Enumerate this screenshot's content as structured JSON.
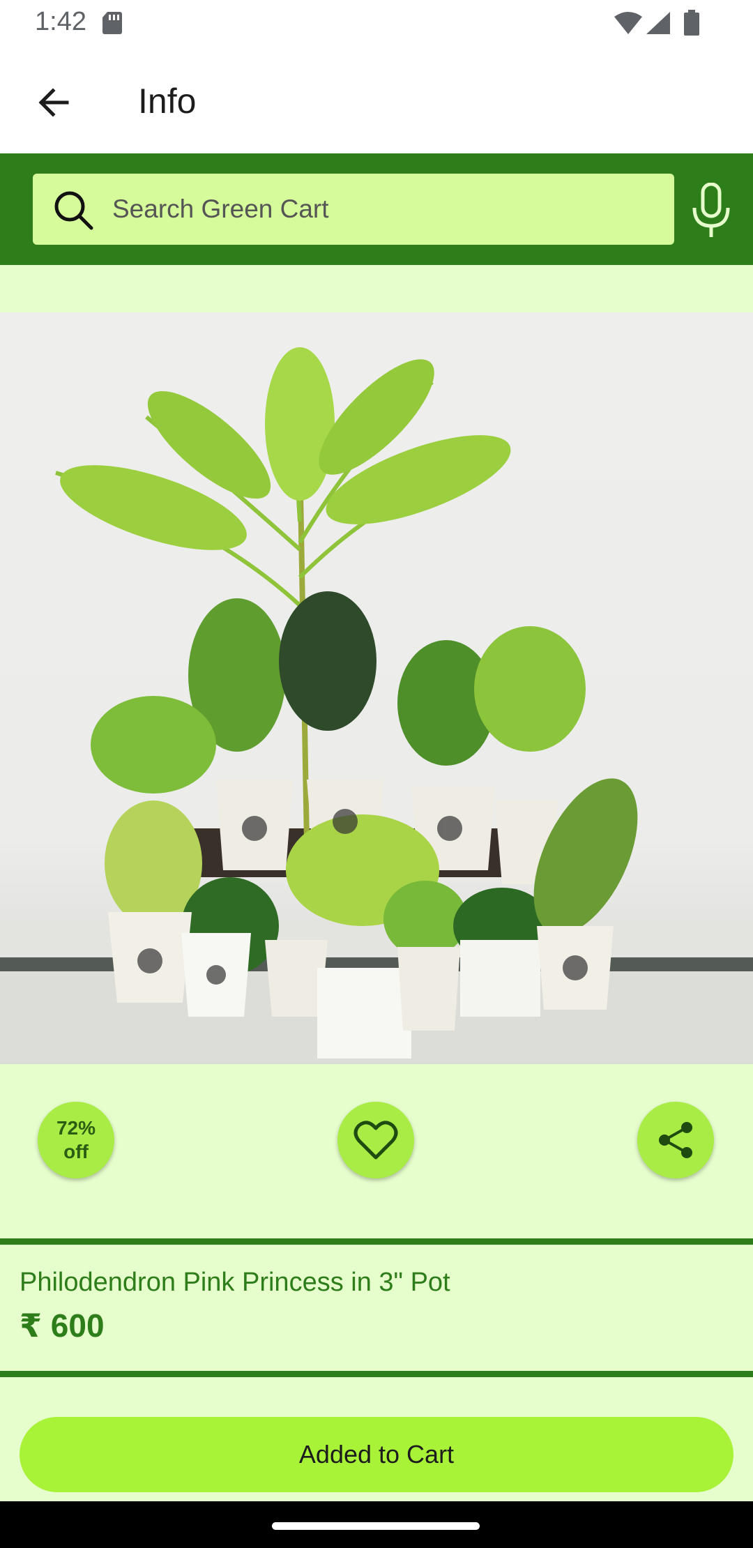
{
  "status_bar": {
    "time": "1:42",
    "icons": [
      "sd-card-icon",
      "wifi-icon",
      "signal-icon",
      "battery-icon"
    ]
  },
  "app_bar": {
    "title": "Info",
    "back_icon": "arrow-back-icon"
  },
  "search": {
    "placeholder": "Search Green Cart",
    "value": "",
    "search_icon": "search-icon",
    "mic_icon": "mic-icon"
  },
  "product": {
    "image_alt": "Assorted potted indoor plants in white decorative pots",
    "discount": "72% off",
    "name": "Philodendron Pink Princess in 3\" Pot",
    "price": "₹ 600"
  },
  "actions": {
    "favorite_icon": "heart-outline-icon",
    "share_icon": "share-icon"
  },
  "cart_button": {
    "label": "Added to Cart"
  },
  "colors": {
    "primary_dark": "#2e7d1b",
    "search_bg": "#d6fb9a",
    "content_bg": "#e6fdcc",
    "accent": "#a8ec45",
    "button": "#a8f238"
  }
}
